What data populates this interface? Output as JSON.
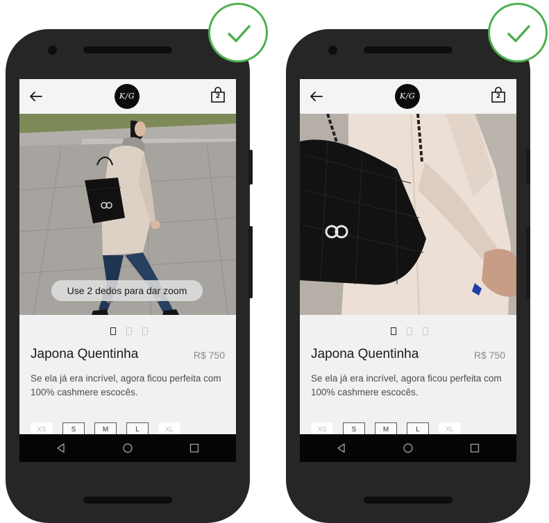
{
  "screens": [
    {
      "logo": "K/G",
      "bag_count": "2",
      "zoom_hint": "Use 2 dedos para dar zoom",
      "active_image": 0,
      "image_count": 3,
      "product_name": "Japona Quentinha",
      "price": "R$ 750",
      "description": "Se ela já era incrível, agora ficou perfeita com 100% cashmere escocês.",
      "sizes": [
        "XS",
        "S",
        "M",
        "L",
        "XL"
      ],
      "status": "approved"
    },
    {
      "logo": "K/G",
      "bag_count": "2",
      "active_image": 0,
      "image_count": 3,
      "product_name": "Japona Quentinha",
      "price": "R$ 750",
      "description": "Se ela já era incrível, agora ficou perfeita com 100% cashmere escocês.",
      "sizes": [
        "XS",
        "S",
        "M",
        "L",
        "XL"
      ],
      "status": "approved"
    }
  ],
  "icons": {
    "top_left": "back-arrow-icon",
    "top_right": "shopping-bag-icon",
    "badge": "checkmark-icon",
    "nav": [
      "nav-back-icon",
      "nav-home-icon",
      "nav-recents-icon"
    ]
  },
  "colors": {
    "check_accent": "#4caf50",
    "phone_body": "#262626",
    "screen_bg": "#f1f1f1",
    "nav_bar": "#050505"
  }
}
